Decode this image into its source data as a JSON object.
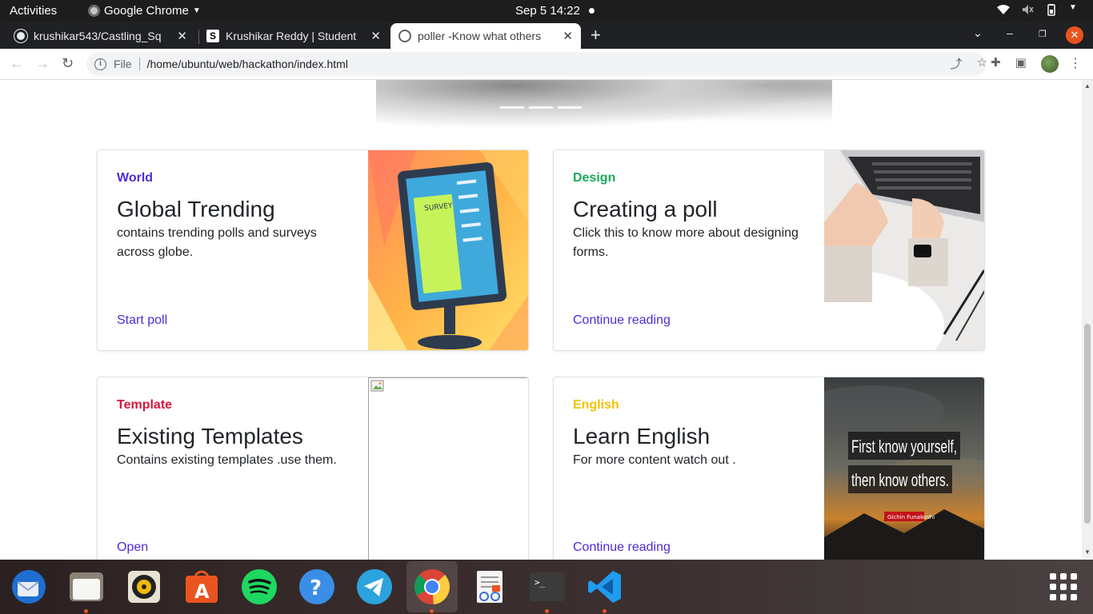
{
  "system_bar": {
    "activities": "Activities",
    "app_menu": "Google Chrome",
    "clock": "Sep 5  14:22"
  },
  "browser": {
    "tabs": [
      {
        "title": "krushikar543/Castling_Sq",
        "active": false
      },
      {
        "title": "Krushikar Reddy | Student",
        "active": false
      },
      {
        "title": "poller -Know what others",
        "active": true
      }
    ],
    "scheme": "File",
    "url": "/home/ubuntu/web/hackathon/index.html"
  },
  "cards": [
    {
      "category": "World",
      "category_color": "#4f2bd6",
      "title": "Global Trending",
      "text": "contains trending polls and surveys across globe.",
      "link": "Start poll"
    },
    {
      "category": "Design",
      "category_color": "#1aaa5a",
      "title": "Creating a poll",
      "text": "Click this to know more about designing forms.",
      "link": "Continue reading"
    },
    {
      "category": "Template",
      "category_color": "#d6163a",
      "title": "Existing Templates",
      "text": "Contains existing templates .use them.",
      "link": "Open"
    },
    {
      "category": "English",
      "category_color": "#f2c400",
      "title": "Learn English",
      "text": "For more content watch out .",
      "link": "Continue reading"
    }
  ],
  "images": {
    "survey_label": "SURVEY",
    "quote_line1": "First know yourself,",
    "quote_line2": "then know others.",
    "quote_author": "Gichin Funakoshi"
  },
  "dock": [
    {
      "icon": "thunderbird-icon",
      "running": false
    },
    {
      "icon": "files-icon",
      "running": true
    },
    {
      "icon": "rhythmbox-icon",
      "running": false
    },
    {
      "icon": "app-center-icon",
      "running": false
    },
    {
      "icon": "spotify-icon",
      "running": false
    },
    {
      "icon": "help-icon",
      "running": false
    },
    {
      "icon": "telegram-icon",
      "running": false
    },
    {
      "icon": "chrome-icon",
      "running": true
    },
    {
      "icon": "text-editor-icon",
      "running": false
    },
    {
      "icon": "terminal-icon",
      "running": true
    },
    {
      "icon": "vscode-icon",
      "running": true
    }
  ]
}
